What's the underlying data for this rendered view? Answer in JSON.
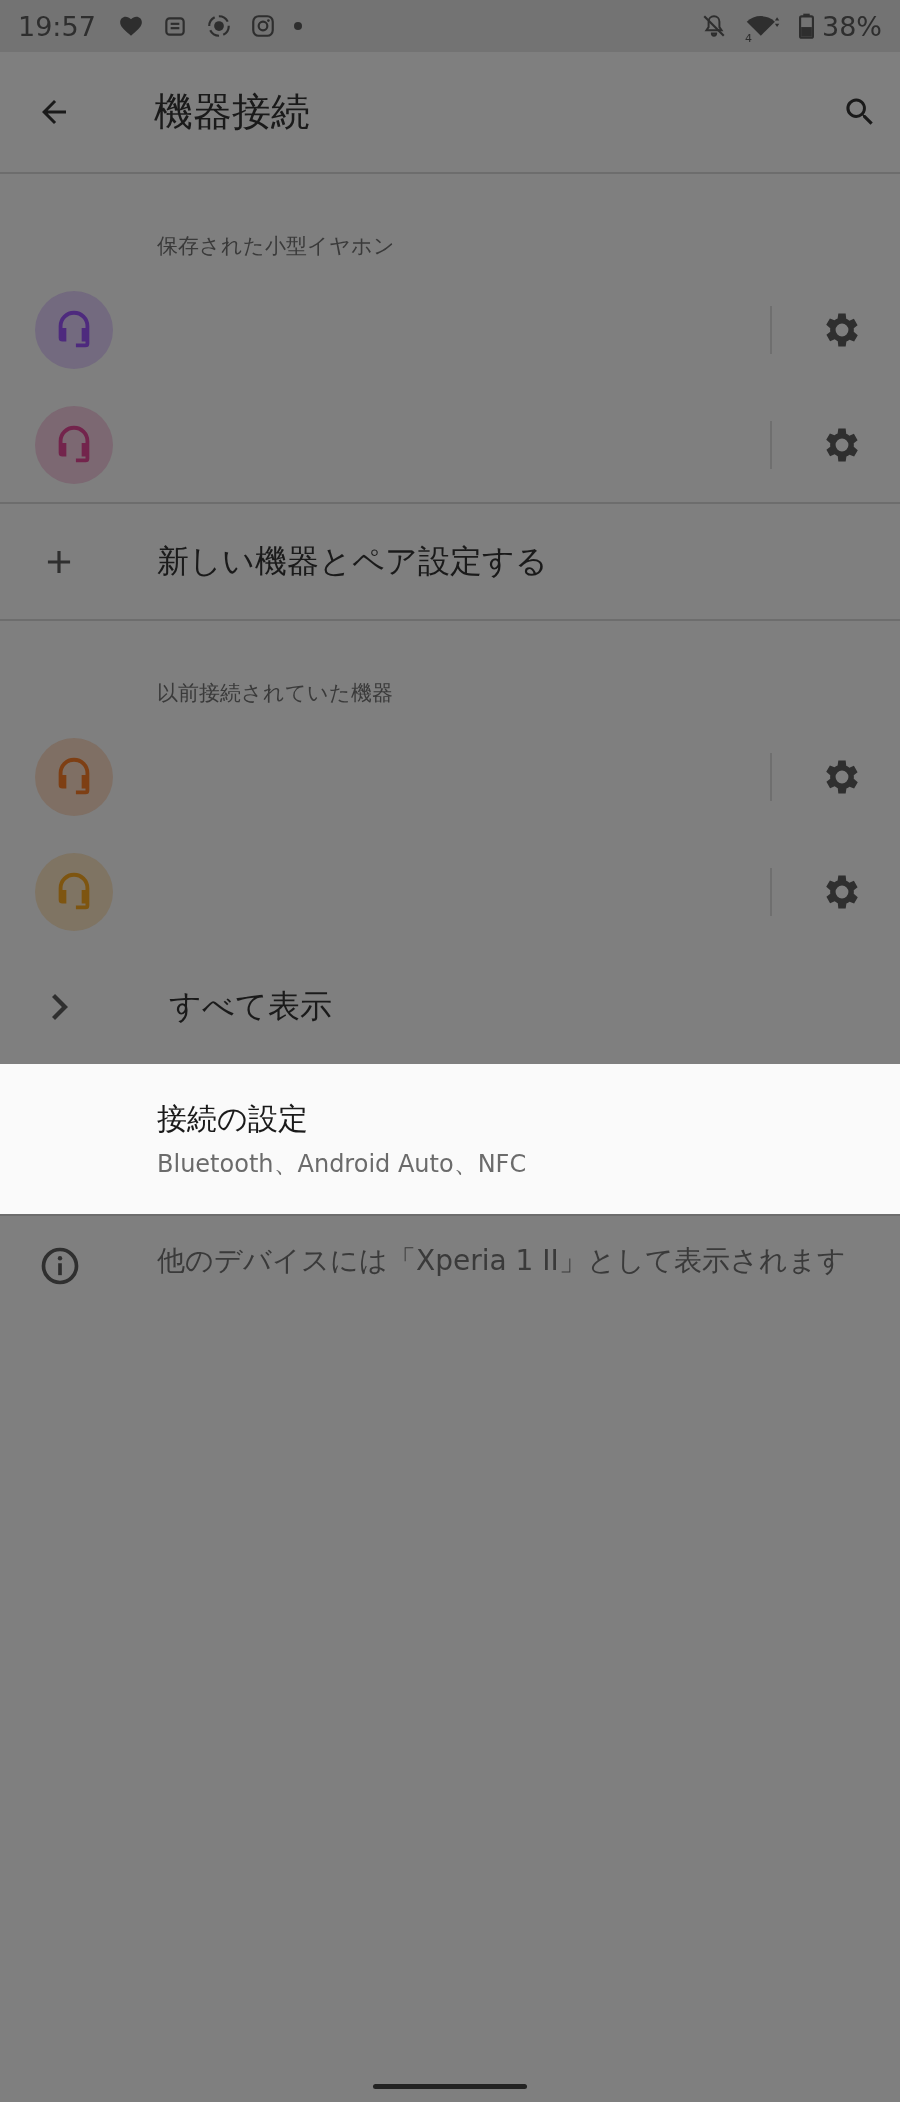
{
  "status_bar": {
    "time": "19:57",
    "wifi_badge": "4",
    "battery": "38%"
  },
  "app_bar": {
    "title": "機器接続"
  },
  "sections": [
    {
      "header": "保存された小型イヤホン",
      "devices": [
        {
          "color": "#4e2a7e"
        },
        {
          "color": "#73244c"
        }
      ]
    },
    {
      "action": {
        "kind": "add",
        "label": "新しい機器とペア設定する"
      }
    },
    {
      "header": "以前接続されていた機器",
      "devices": [
        {
          "color": "#7e3f14"
        },
        {
          "color": "#7e5510"
        }
      ]
    },
    {
      "action": {
        "kind": "more",
        "label": "すべて表示"
      }
    }
  ],
  "highlighted_item": {
    "title": "接続の設定",
    "subtitle": "Bluetooth、Android Auto、NFC"
  },
  "footer_info": "他のデバイスには「Xperia 1 II」として表示されます"
}
